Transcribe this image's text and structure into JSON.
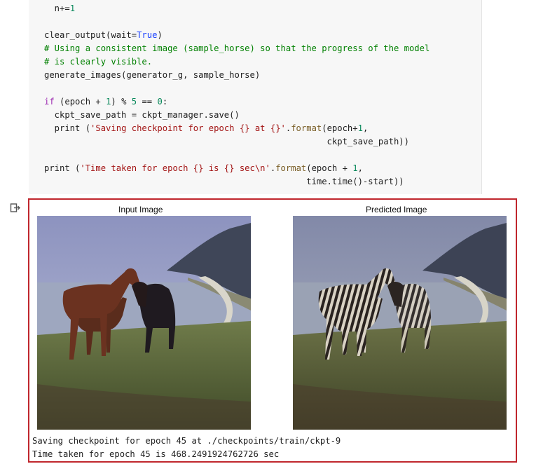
{
  "code_lines": [
    {
      "segments": [
        {
          "t": "  n+=",
          "c": ""
        },
        {
          "t": "1",
          "c": "num"
        }
      ]
    },
    {
      "segments": []
    },
    {
      "segments": [
        {
          "t": "clear_output(wait=",
          "c": ""
        },
        {
          "t": "True",
          "c": "cons"
        },
        {
          "t": ")",
          "c": ""
        }
      ]
    },
    {
      "segments": [
        {
          "t": "# Using a consistent image (sample_horse) so that the progress of the model",
          "c": "cmt"
        }
      ]
    },
    {
      "segments": [
        {
          "t": "# is clearly visible.",
          "c": "cmt"
        }
      ]
    },
    {
      "segments": [
        {
          "t": "generate_images(generator_g, sample_horse)",
          "c": ""
        }
      ]
    },
    {
      "segments": []
    },
    {
      "segments": [
        {
          "t": "if",
          "c": "kw"
        },
        {
          "t": " (epoch + ",
          "c": ""
        },
        {
          "t": "1",
          "c": "num"
        },
        {
          "t": ") % ",
          "c": ""
        },
        {
          "t": "5",
          "c": "num"
        },
        {
          "t": " == ",
          "c": ""
        },
        {
          "t": "0",
          "c": "num"
        },
        {
          "t": ":",
          "c": ""
        }
      ]
    },
    {
      "segments": [
        {
          "t": "  ckpt_save_path = ckpt_manager.save()",
          "c": ""
        }
      ]
    },
    {
      "segments": [
        {
          "t": "  print (",
          "c": ""
        },
        {
          "t": "'Saving checkpoint for epoch {} at {}'",
          "c": "str"
        },
        {
          "t": ".",
          "c": ""
        },
        {
          "t": "format",
          "c": "fn"
        },
        {
          "t": "(epoch+",
          "c": ""
        },
        {
          "t": "1",
          "c": "num"
        },
        {
          "t": ",",
          "c": ""
        }
      ]
    },
    {
      "segments": [
        {
          "t": "                                                       ckpt_save_path))",
          "c": ""
        }
      ]
    },
    {
      "segments": []
    },
    {
      "segments": [
        {
          "t": "print (",
          "c": ""
        },
        {
          "t": "'Time taken for epoch {} is {} sec\\n'",
          "c": "str"
        },
        {
          "t": ".",
          "c": ""
        },
        {
          "t": "format",
          "c": "fn"
        },
        {
          "t": "(epoch + ",
          "c": ""
        },
        {
          "t": "1",
          "c": "num"
        },
        {
          "t": ",",
          "c": ""
        }
      ]
    },
    {
      "segments": [
        {
          "t": "                                                   time.time()-start))",
          "c": ""
        }
      ]
    }
  ],
  "output": {
    "input_title": "Input Image",
    "predicted_title": "Predicted Image",
    "lines": [
      "Saving checkpoint for epoch 45 at ./checkpoints/train/ckpt-9",
      "Time taken for epoch 45 is 468.2491924762726 sec"
    ]
  },
  "icons": {
    "output_icon": "output-arrow-icon"
  },
  "colors": {
    "highlight_border": "#c0272d",
    "code_background": "#f7f7f7"
  }
}
